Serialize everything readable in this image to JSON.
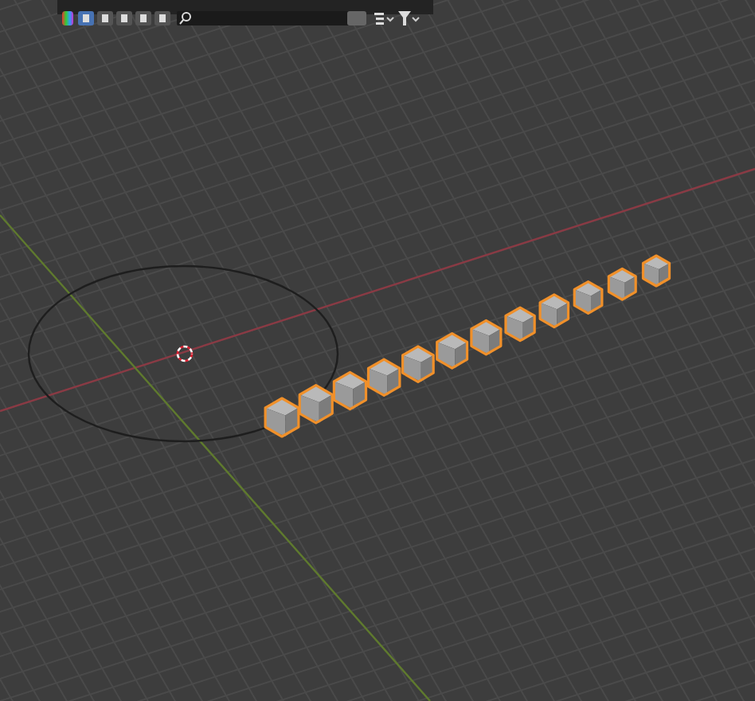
{
  "header": {
    "icons": [
      {
        "kind": "palette"
      },
      {
        "kind": "view",
        "selected": true
      },
      {
        "kind": "toggle",
        "selected": false
      },
      {
        "kind": "toggle",
        "selected": false
      },
      {
        "kind": "toggle",
        "selected": false
      },
      {
        "kind": "toggle",
        "selected": false
      }
    ],
    "search": {
      "kind": "search"
    },
    "right": [
      {
        "kind": "button"
      },
      {
        "kind": "list"
      },
      {
        "kind": "funnel"
      }
    ]
  },
  "viewport": {
    "objects": [
      {
        "kind": "cube",
        "selected": true
      },
      {
        "kind": "cube",
        "selected": true
      },
      {
        "kind": "cube",
        "selected": true
      },
      {
        "kind": "cube",
        "selected": true
      },
      {
        "kind": "cube",
        "selected": true
      },
      {
        "kind": "cube",
        "selected": true
      },
      {
        "kind": "cube",
        "selected": true
      },
      {
        "kind": "cube",
        "selected": true
      },
      {
        "kind": "cube",
        "selected": true
      },
      {
        "kind": "cube",
        "selected": true
      },
      {
        "kind": "cube",
        "selected": true
      },
      {
        "kind": "cube",
        "selected": true
      }
    ]
  }
}
